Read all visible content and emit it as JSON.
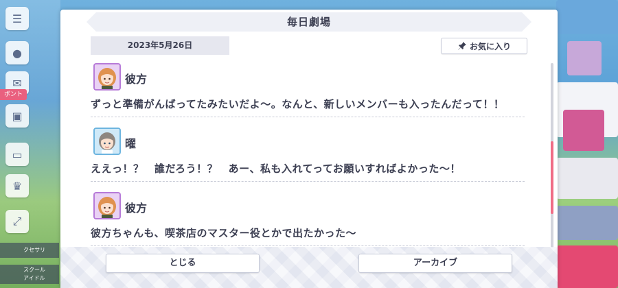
{
  "dialog": {
    "title": "毎日劇場",
    "date": "2023年5月26日",
    "favorite_label": "お気に入り",
    "close_label": "とじる",
    "archive_label": "アーカイブ"
  },
  "messages": [
    {
      "speaker": "彼方",
      "text": "ずっと準備がんばってたみたいだよ〜。なんと、新しいメンバーも入ったんだって！！",
      "avatar_color": "#d8b4ec"
    },
    {
      "speaker": "曜",
      "text": "ええっ！？　誰だろう！？　あー、私も入れてってお願いすればよかった〜！",
      "avatar_color": "#b3dcf3"
    },
    {
      "speaker": "彼方",
      "text": "彼方ちゃんも、喫茶店のマスター役とかで出たかった〜",
      "avatar_color": "#d8b4ec"
    }
  ],
  "background": {
    "side_tags": [
      "ボント"
    ],
    "side_labels": [
      "クセサリ",
      "スクール\nアイドル"
    ]
  },
  "colors": {
    "accent": "#f06d86",
    "text": "#3c3f52",
    "date_bg": "#e6e7ef"
  },
  "icons": [
    "pin-icon",
    "menu-icon",
    "mail-icon",
    "gift-icon",
    "trophy-icon"
  ]
}
